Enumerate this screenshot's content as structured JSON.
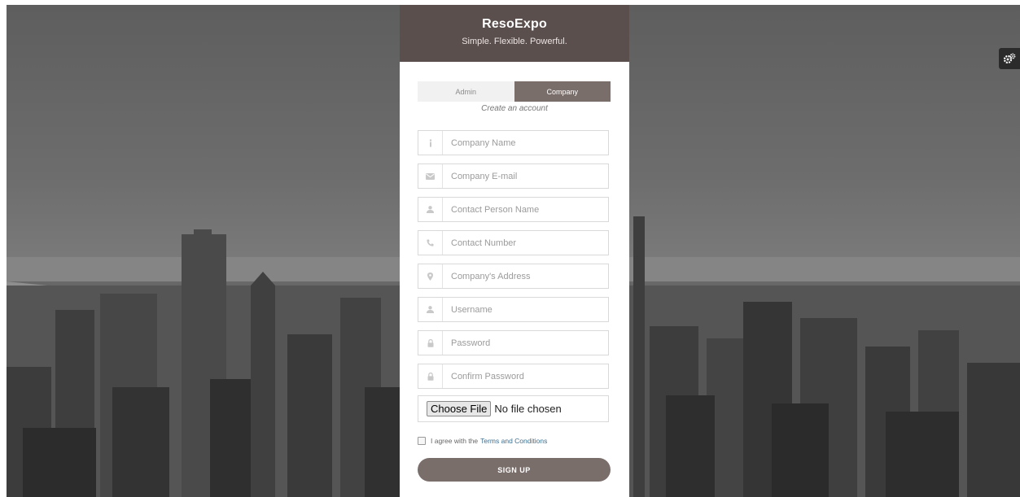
{
  "brand": {
    "name": "ResoExpo",
    "tagline": "Simple. Flexible. Powerful."
  },
  "tabs": [
    {
      "label": "Admin",
      "active": false
    },
    {
      "label": "Company",
      "active": true
    }
  ],
  "subtitle": "Create an account",
  "fields": [
    {
      "icon": "info-icon",
      "placeholder": "Company Name",
      "value": ""
    },
    {
      "icon": "envelope-icon",
      "placeholder": "Company E-mail",
      "value": ""
    },
    {
      "icon": "user-icon",
      "placeholder": "Contact Person Name",
      "value": ""
    },
    {
      "icon": "phone-icon",
      "placeholder": "Contact Number",
      "value": ""
    },
    {
      "icon": "map-marker-icon",
      "placeholder": "Company's Address",
      "value": ""
    },
    {
      "icon": "user-icon",
      "placeholder": "Username",
      "value": ""
    },
    {
      "icon": "lock-icon",
      "placeholder": "Password",
      "value": ""
    },
    {
      "icon": "lock-icon",
      "placeholder": "Confirm Password",
      "value": ""
    }
  ],
  "file_upload": {
    "button_label": "Choose File",
    "status": "No file chosen"
  },
  "agree": {
    "prefix": "I agree with the",
    "link": "Terms and Conditions",
    "checked": false
  },
  "signup_label": "SIGN UP",
  "colors": {
    "header": "#5b4f4d",
    "accent": "#7a6e6b",
    "link": "#3b6e8f"
  },
  "settings_icon": "gears-icon"
}
